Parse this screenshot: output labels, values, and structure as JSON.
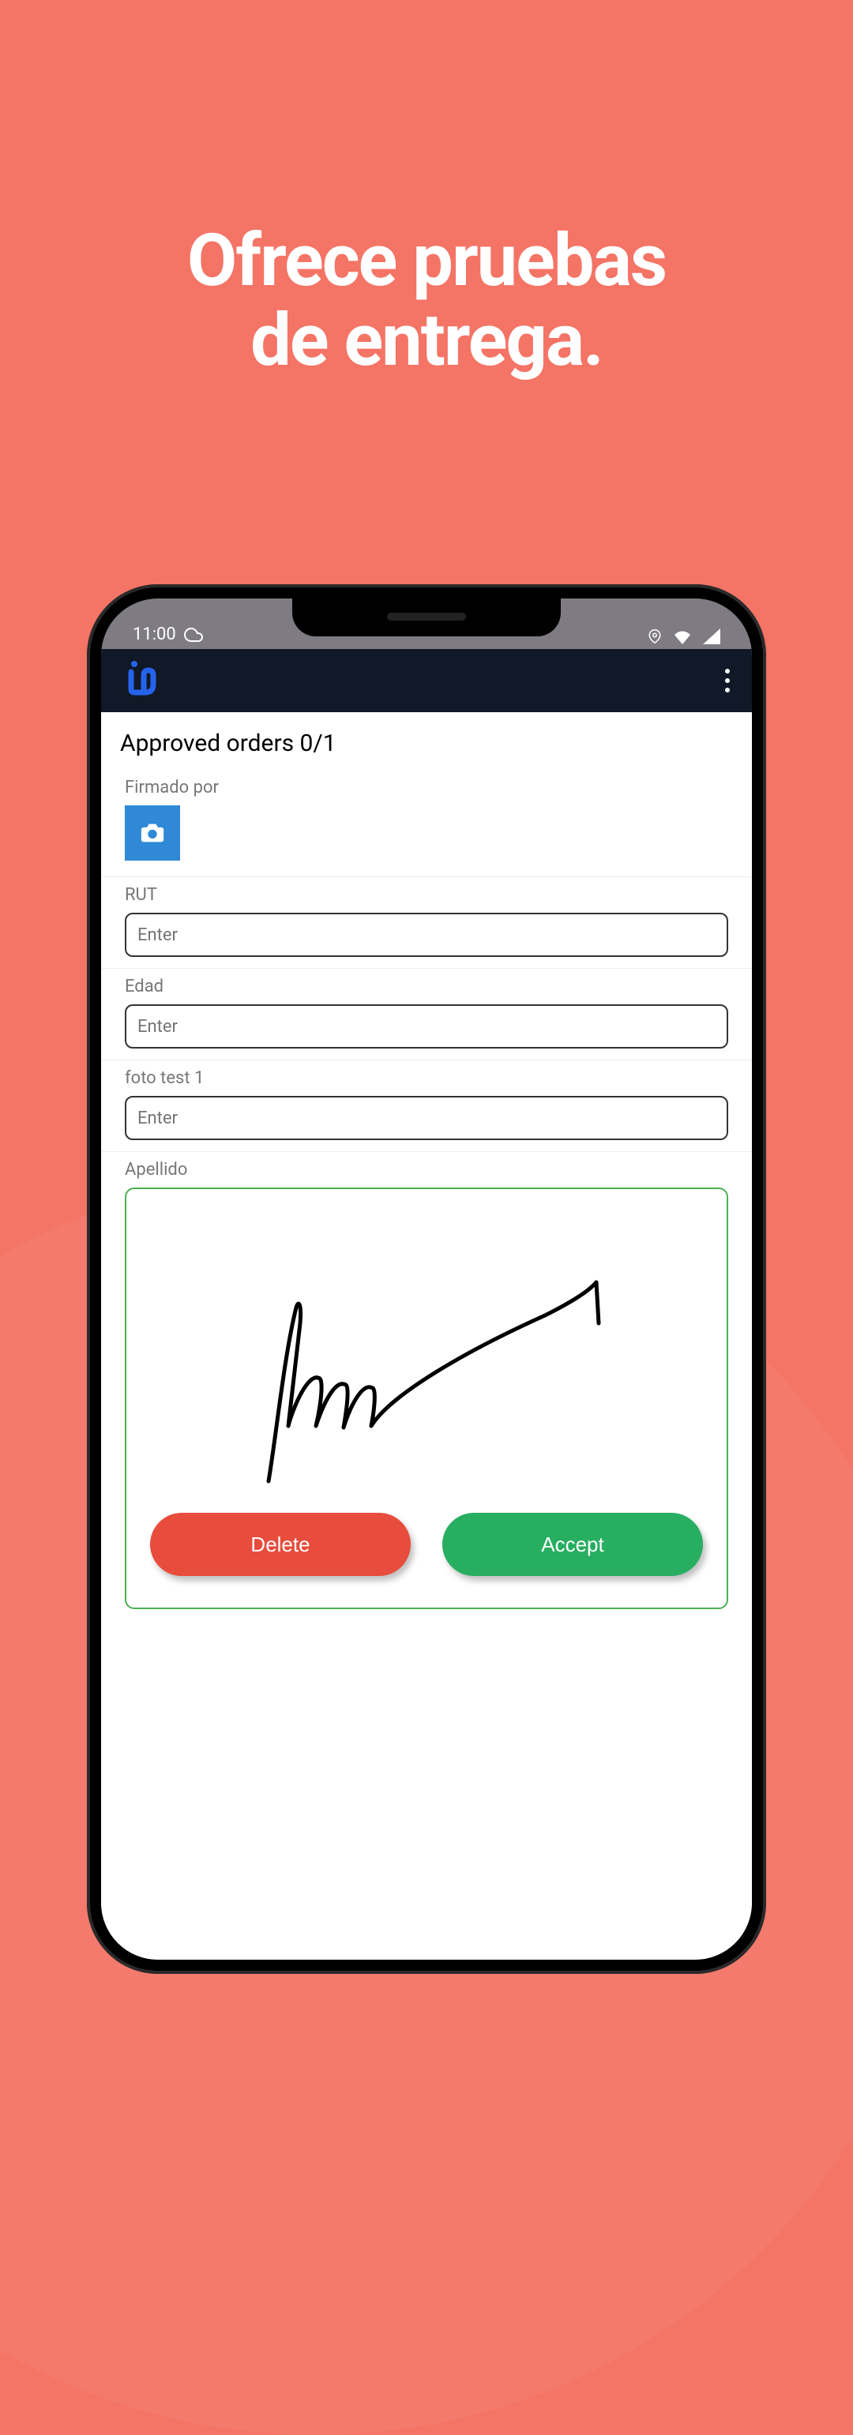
{
  "marketing": {
    "headline_line1": "Ofrece pruebas",
    "headline_line2": "de entrega."
  },
  "status_bar": {
    "time": "11:00"
  },
  "app_bar": {
    "logo_text": "in"
  },
  "page": {
    "title": "Approved orders 0/1"
  },
  "fields": {
    "firmado_por": {
      "label": "Firmado por"
    },
    "rut": {
      "label": "RUT",
      "placeholder": "Enter",
      "value": ""
    },
    "edad": {
      "label": "Edad",
      "placeholder": "Enter",
      "value": ""
    },
    "foto_test_1": {
      "label": "foto test 1",
      "placeholder": "Enter",
      "value": ""
    },
    "apellido": {
      "label": "Apellido"
    }
  },
  "signature": {
    "delete_label": "Delete",
    "accept_label": "Accept"
  },
  "colors": {
    "background": "#F47466",
    "app_bar": "#111827",
    "logo": "#2563EB",
    "camera_button": "#2F89D6",
    "signature_border": "#4CAF50",
    "delete_button": "#E74C3C",
    "accept_button": "#27AE60"
  }
}
